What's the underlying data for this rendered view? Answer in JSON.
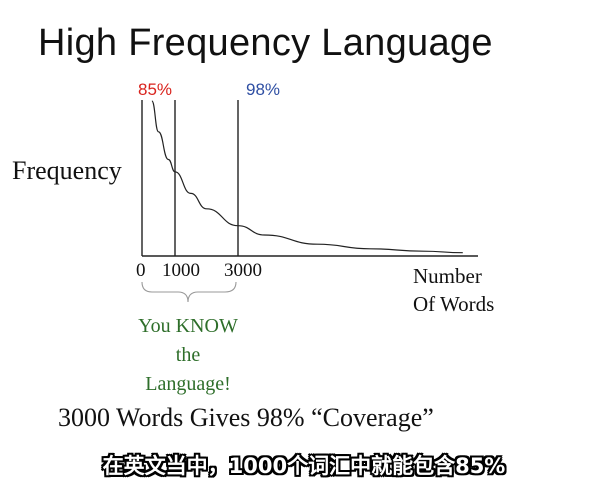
{
  "slide": {
    "title": "High Frequency Language",
    "coverage_caption": "3000 Words Gives 98% “Coverage”",
    "subtitle": "在英文当中，1000个词汇中就能包含85%"
  },
  "annotation": {
    "lines": [
      "You KNOW",
      "the",
      "Language!"
    ],
    "color": "#2e6e2a"
  },
  "chart_data": {
    "type": "line",
    "title": "",
    "xlabel": "Number Of Words",
    "xlabel_lines": [
      "Number",
      "Of Words"
    ],
    "ylabel": "Frequency",
    "x_tick_labels": [
      "0",
      "1000",
      "3000"
    ],
    "x_ticks": [
      0,
      1000,
      3000
    ],
    "xlim": [
      0,
      12000
    ],
    "curve": "decaying frequency curve (Zipf-like)",
    "series": [
      {
        "x": [
          300,
          500,
          800,
          1000,
          1500,
          2000,
          3000,
          4000,
          6000,
          8000,
          10000,
          11500
        ],
        "y": [
          1.0,
          0.8,
          0.62,
          0.54,
          0.4,
          0.3,
          0.19,
          0.13,
          0.07,
          0.04,
          0.025,
          0.015
        ]
      }
    ],
    "ylim": [
      0,
      1
    ],
    "markers": [
      {
        "x": 1000,
        "label": "85%",
        "color": "#d9231d"
      },
      {
        "x": 3000,
        "label": "98%",
        "color": "#2f4fa3"
      }
    ],
    "grid": false,
    "legend": "none"
  }
}
